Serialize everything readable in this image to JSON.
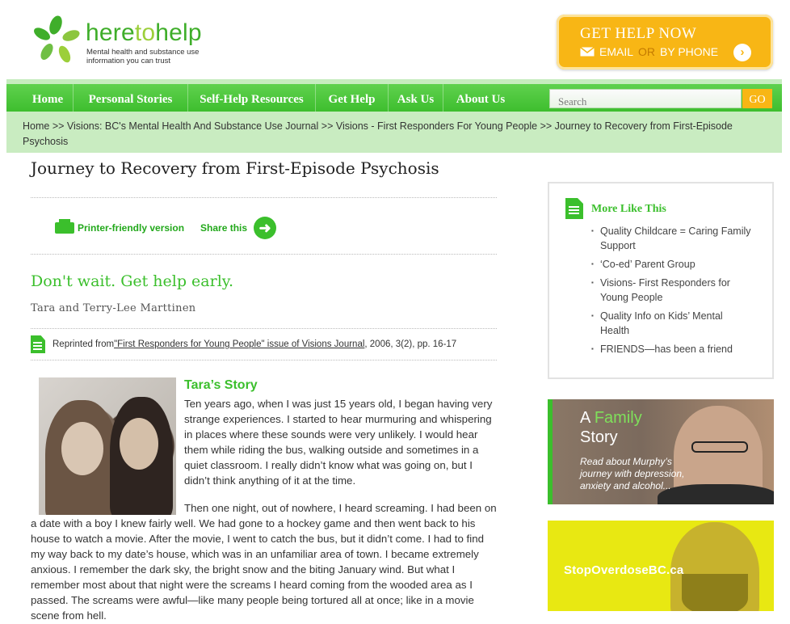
{
  "brand": {
    "name_here": "here",
    "name_to": "to",
    "name_help": "help",
    "tagline": "Mental health and substance use information you can trust",
    "colors": {
      "green": "#3bbf2c",
      "light_green": "#c9ecc1",
      "orange": "#f8b615"
    }
  },
  "get_help": {
    "title": "GET HELP NOW",
    "email": "EMAIL",
    "or": "OR",
    "phone": "BY PHONE",
    "icon": "chevron-right-icon"
  },
  "nav": {
    "items": [
      "Home",
      "Personal Stories",
      "Self-Help Resources",
      "Get Help",
      "Ask Us",
      "About Us"
    ],
    "search_placeholder": "Search",
    "go_label": "GO"
  },
  "breadcrumb": {
    "items": [
      "Home",
      "Visions: BC's Mental Health And Substance Use Journal",
      "Visions - First Responders For Young People",
      "Journey to Recovery from First-Episode Psychosis"
    ],
    "separator": ">>"
  },
  "article": {
    "title": "Journey to Recovery from First-Episode Psychosis",
    "printer_label": "Printer-friendly version",
    "share_label": "Share this",
    "subtitle": "Don't wait. Get help early.",
    "author": "Tara and Terry-Lee Marttinen",
    "reprint_prefix": "Reprinted from ",
    "reprint_link": "\"First Responders for Young People\" issue of Visions Journal",
    "reprint_suffix": ", 2006, 3(2), pp. 16-17",
    "section_heading": "Tara’s Story",
    "para1": "Ten years ago, when I was just 15 years old, I began having very strange experiences. I started to hear murmuring and whispering in places where these sounds were very unlikely. I would hear them while riding the bus, walking outside and sometimes in a quiet classroom. I really didn’t know what was going on, but I didn’t think anything of it at the time.",
    "para2": "Then one night, out of nowhere, I heard screaming. I had been on a date with a boy I knew fairly well. We had gone to a hockey game and then went back to his house to watch a movie. After the movie, I went to catch the bus, but it didn’t come. I had to find my way back to my date’s house, which was in an unfamiliar area of town. I became extremely anxious. I remember the dark sky, the bright snow and the biting January wind. But what I remember most about that night were the screams I heard coming from the wooded area as I passed. The screams were awful—like many people being tortured all at once; like in a movie scene from hell."
  },
  "sidebar": {
    "more_title": "More Like This",
    "more_items": [
      "Quality Childcare = Caring Family Support",
      "‘Co-ed’ Parent Group",
      "Visions- First Responders for Young People",
      "Quality Info on Kids’ Mental Health",
      "FRIENDS—has been a friend"
    ],
    "ad_family": {
      "a": "A",
      "family": "Family",
      "story": "Story",
      "tagline": "Read about Murphy’s journey with depression, anxiety and alcohol..."
    },
    "ad_overdose": {
      "text": "StopOverdoseBC.ca"
    }
  }
}
